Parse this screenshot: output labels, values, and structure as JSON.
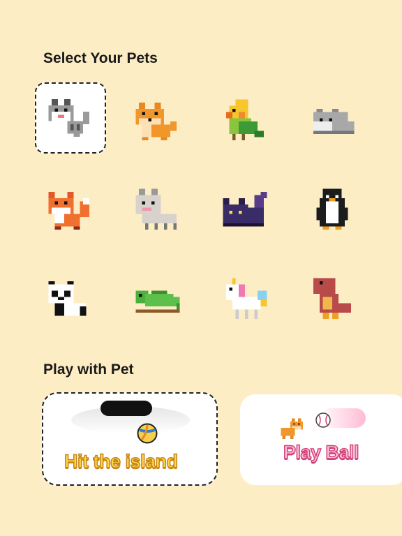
{
  "sections": {
    "select_title": "Select Your Pets",
    "play_title": "Play with Pet"
  },
  "pets": [
    {
      "icon": "gray-cat-icon",
      "selected": true
    },
    {
      "icon": "shiba-dog-icon",
      "selected": false
    },
    {
      "icon": "parrot-icon",
      "selected": false
    },
    {
      "icon": "hamster-icon",
      "selected": false
    },
    {
      "icon": "fox-icon",
      "selected": false
    },
    {
      "icon": "alpaca-icon",
      "selected": false
    },
    {
      "icon": "black-cat-icon",
      "selected": false
    },
    {
      "icon": "penguin-icon",
      "selected": false
    },
    {
      "icon": "panda-icon",
      "selected": false
    },
    {
      "icon": "chameleon-icon",
      "selected": false
    },
    {
      "icon": "unicorn-icon",
      "selected": false
    },
    {
      "icon": "dinosaur-icon",
      "selected": false
    }
  ],
  "games": {
    "island": {
      "label": "Hit the island",
      "icon": "volleyball-icon",
      "color": "#ffd84a"
    },
    "ball": {
      "label": "Play Ball",
      "icon": "baseball-icon",
      "color": "#ffc1d6"
    }
  },
  "colors": {
    "background": "#fdedc4",
    "card": "#ffffff"
  }
}
